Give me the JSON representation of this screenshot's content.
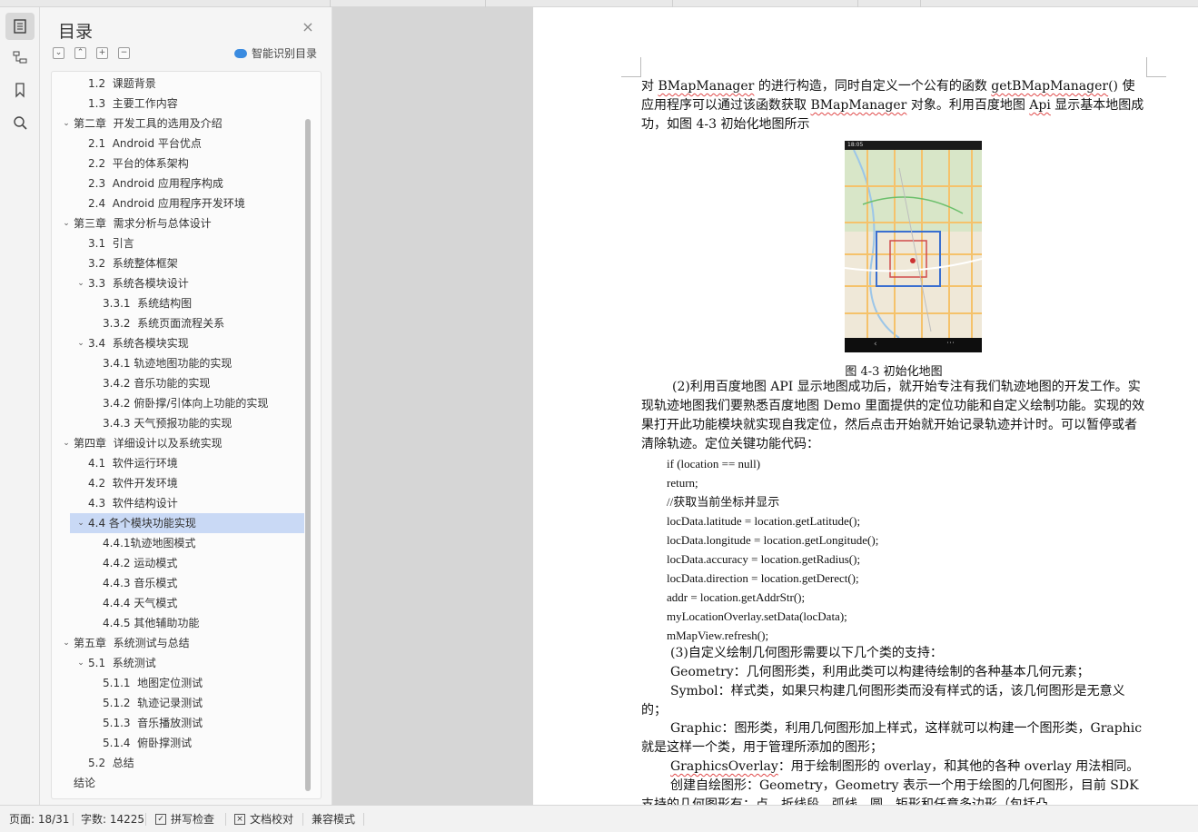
{
  "toc": {
    "title": "目录",
    "close_glyph": "×",
    "smart_label": "智能识别目录",
    "tools": [
      "⌄",
      "⌃",
      "+",
      "−"
    ],
    "items": [
      {
        "label": "1.2  课题背景",
        "level": 2,
        "arrow": ""
      },
      {
        "label": "1.3  主要工作内容",
        "level": 2,
        "arrow": ""
      },
      {
        "label": "第二章  开发工具的选用及介绍",
        "level": 1,
        "arrow": "⌄"
      },
      {
        "label": "2.1  Android 平台优点",
        "level": 2,
        "arrow": ""
      },
      {
        "label": "2.2  平台的体系架构",
        "level": 2,
        "arrow": ""
      },
      {
        "label": "2.3  Android 应用程序构成",
        "level": 2,
        "arrow": ""
      },
      {
        "label": "2.4  Android 应用程序开发环境",
        "level": 2,
        "arrow": ""
      },
      {
        "label": "第三章  需求分析与总体设计",
        "level": 1,
        "arrow": "⌄"
      },
      {
        "label": "3.1  引言",
        "level": 2,
        "arrow": ""
      },
      {
        "label": "3.2  系统整体框架",
        "level": 2,
        "arrow": ""
      },
      {
        "label": "3.3  系统各模块设计",
        "level": 2,
        "arrow": "⌄"
      },
      {
        "label": "3.3.1  系统结构图",
        "level": 3,
        "arrow": ""
      },
      {
        "label": "3.3.2  系统页面流程关系",
        "level": 3,
        "arrow": ""
      },
      {
        "label": "3.4  系统各模块实现",
        "level": 2,
        "arrow": "⌄"
      },
      {
        "label": "3.4.1 轨迹地图功能的实现",
        "level": 3,
        "arrow": ""
      },
      {
        "label": "3.4.2 音乐功能的实现",
        "level": 3,
        "arrow": ""
      },
      {
        "label": "3.4.2 俯卧撑/引体向上功能的实现",
        "level": 3,
        "arrow": ""
      },
      {
        "label": "3.4.3 天气预报功能的实现",
        "level": 3,
        "arrow": ""
      },
      {
        "label": "第四章  详细设计以及系统实现",
        "level": 1,
        "arrow": "⌄"
      },
      {
        "label": "4.1  软件运行环境",
        "level": 2,
        "arrow": ""
      },
      {
        "label": "4.2  软件开发环境",
        "level": 2,
        "arrow": ""
      },
      {
        "label": "4.3  软件结构设计",
        "level": 2,
        "arrow": ""
      },
      {
        "label": "4.4 各个模块功能实现",
        "level": 2,
        "arrow": "⌄",
        "selected": true
      },
      {
        "label": "4.4.1轨迹地图模式",
        "level": 3,
        "arrow": ""
      },
      {
        "label": "4.4.2 运动模式",
        "level": 3,
        "arrow": ""
      },
      {
        "label": "4.4.3 音乐模式",
        "level": 3,
        "arrow": ""
      },
      {
        "label": "4.4.4 天气模式",
        "level": 3,
        "arrow": ""
      },
      {
        "label": "4.4.5 其他辅助功能",
        "level": 3,
        "arrow": ""
      },
      {
        "label": "第五章  系统测试与总结",
        "level": 1,
        "arrow": "⌄"
      },
      {
        "label": "5.1  系统测试",
        "level": 2,
        "arrow": "⌄"
      },
      {
        "label": "5.1.1  地图定位测试",
        "level": 3,
        "arrow": ""
      },
      {
        "label": "5.1.2  轨迹记录测试",
        "level": 3,
        "arrow": ""
      },
      {
        "label": "5.1.3  音乐播放测试",
        "level": 3,
        "arrow": ""
      },
      {
        "label": "5.1.4  俯卧撑测试",
        "level": 3,
        "arrow": ""
      },
      {
        "label": "5.2  总结",
        "level": 2,
        "arrow": ""
      },
      {
        "label": "结论",
        "level": 1,
        "arrow": ""
      }
    ]
  },
  "doc": {
    "p1": [
      "对 ",
      "BMapManager",
      " 的进行构造，同时自定义一个公有的函数 ",
      "getBMapManager",
      "() 使应用程序可以通过该函数获取 ",
      "BMapManager",
      " 对象。利用百度地图 ",
      "Api",
      " 显示基本地图成功，如图 4-3 初始化地图所示"
    ],
    "phone_time": "18:05",
    "caption": "图 4-3 初始化地图",
    "p2": "(2)利用百度地图 API 显示地图成功后，就开始专注有我们轨迹地图的开发工作。实现轨迹地图我们要熟悉百度地图 Demo 里面提供的定位功能和自定义绘制功能。实现的效果打开此功能模块就实现自我定位，然后点击开始就开始记录轨迹并计时。可以暂停或者清除轨迹。定位关键功能代码：",
    "code": [
      "if (location == null)",
      "return;",
      "//获取当前坐标并显示",
      "locData.latitude = location.getLatitude();",
      "locData.longitude = location.getLongitude();",
      "locData.accuracy = location.getRadius();",
      "locData.direction = location.getDerect();",
      "addr = location.getAddrStr();",
      "myLocationOverlay.setData(locData);",
      "mMapView.refresh();"
    ],
    "p3": "(3)自定义绘制几何图形需要以下几个类的支持：",
    "p4": "Geometry：几何图形类，利用此类可以构建待绘制的各种基本几何元素；",
    "p5": "Symbol：样式类，如果只构建几何图形类而没有样式的话，该几何图形是无意义的；",
    "p6": "Graphic：图形类，利用几何图形加上样式，这样就可以构建一个图形类，Graphic 就是这样一个类，用于管理所添加的图形；",
    "p7a": "GraphicsOverlay",
    "p7b": "：用于绘制图形的 overlay，和其他的各种 overlay 用法相同。",
    "p8": "创建自绘图形：Geometry，Geometry 表示一个用于绘图的几何图形，目前 SDK 支持的几何图形有：点、折线段、弧线、圆、矩形和任意多边形（包括凸"
  },
  "statusbar": {
    "page": "页面: 18/31",
    "words": "字数: 14225",
    "spell": "拼写检查",
    "proof": "文档校对",
    "compat": "兼容模式"
  }
}
